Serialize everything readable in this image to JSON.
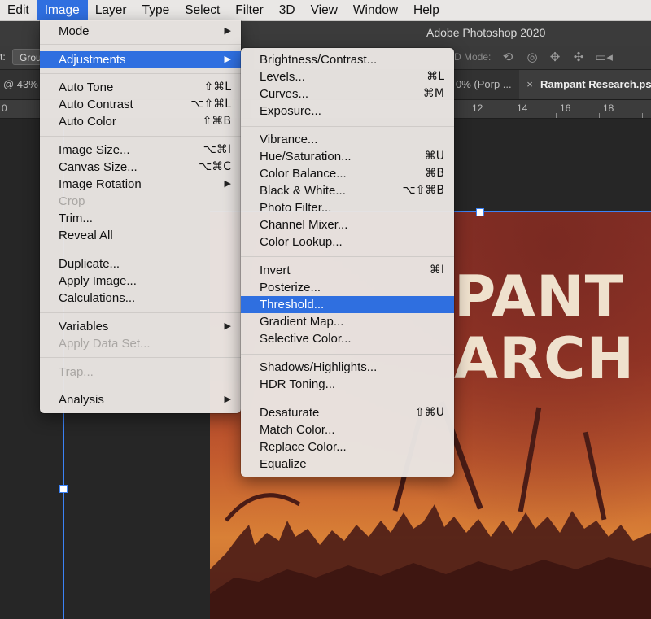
{
  "menubar": {
    "items": [
      "Edit",
      "Image",
      "Layer",
      "Type",
      "Select",
      "Filter",
      "3D",
      "View",
      "Window",
      "Help"
    ],
    "active": "Image"
  },
  "app_title": "Adobe Photoshop 2020",
  "options": {
    "label": "t:",
    "select_value": "Grou",
    "mode_3d": "D Mode:",
    "icons": [
      "orbit-icon",
      "roll-icon",
      "pan-icon",
      "slide-icon",
      "video-camera-icon"
    ]
  },
  "tabs": {
    "left": "@ 43%",
    "middle": "0% (Porp ...",
    "active": "Rampant Research.ps",
    "close_glyph": "×"
  },
  "ruler": {
    "numbers": [
      "0",
      "12",
      "14",
      "16",
      "18"
    ]
  },
  "poster": {
    "line1": "PANT",
    "line2": "ARCH"
  },
  "image_menu": {
    "items": [
      {
        "label": "Mode",
        "submenu": true
      },
      {
        "separator": true
      },
      {
        "label": "Adjustments",
        "submenu": true,
        "highlighted": true
      },
      {
        "separator": true
      },
      {
        "label": "Auto Tone",
        "shortcut": "⇧⌘L"
      },
      {
        "label": "Auto Contrast",
        "shortcut": "⌥⇧⌘L"
      },
      {
        "label": "Auto Color",
        "shortcut": "⇧⌘B"
      },
      {
        "separator": true
      },
      {
        "label": "Image Size...",
        "shortcut": "⌥⌘I"
      },
      {
        "label": "Canvas Size...",
        "shortcut": "⌥⌘C"
      },
      {
        "label": "Image Rotation",
        "submenu": true
      },
      {
        "label": "Crop",
        "disabled": true
      },
      {
        "label": "Trim..."
      },
      {
        "label": "Reveal All"
      },
      {
        "separator": true
      },
      {
        "label": "Duplicate..."
      },
      {
        "label": "Apply Image..."
      },
      {
        "label": "Calculations..."
      },
      {
        "separator": true
      },
      {
        "label": "Variables",
        "submenu": true
      },
      {
        "label": "Apply Data Set...",
        "disabled": true
      },
      {
        "separator": true
      },
      {
        "label": "Trap...",
        "disabled": true
      },
      {
        "separator": true
      },
      {
        "label": "Analysis",
        "submenu": true
      }
    ]
  },
  "adjustments_menu": {
    "items": [
      {
        "label": "Brightness/Contrast..."
      },
      {
        "label": "Levels...",
        "shortcut": "⌘L"
      },
      {
        "label": "Curves...",
        "shortcut": "⌘M"
      },
      {
        "label": "Exposure..."
      },
      {
        "separator": true
      },
      {
        "label": "Vibrance..."
      },
      {
        "label": "Hue/Saturation...",
        "shortcut": "⌘U"
      },
      {
        "label": "Color Balance...",
        "shortcut": "⌘B"
      },
      {
        "label": "Black & White...",
        "shortcut": "⌥⇧⌘B"
      },
      {
        "label": "Photo Filter..."
      },
      {
        "label": "Channel Mixer..."
      },
      {
        "label": "Color Lookup..."
      },
      {
        "separator": true
      },
      {
        "label": "Invert",
        "shortcut": "⌘I"
      },
      {
        "label": "Posterize..."
      },
      {
        "label": "Threshold...",
        "highlighted": true
      },
      {
        "label": "Gradient Map..."
      },
      {
        "label": "Selective Color..."
      },
      {
        "separator": true
      },
      {
        "label": "Shadows/Highlights..."
      },
      {
        "label": "HDR Toning..."
      },
      {
        "separator": true
      },
      {
        "label": "Desaturate",
        "shortcut": "⇧⌘U"
      },
      {
        "label": "Match Color..."
      },
      {
        "label": "Replace Color..."
      },
      {
        "label": "Equalize"
      }
    ]
  },
  "colors": {
    "highlight": "#2f6fe0",
    "guide": "#3b82f6",
    "poster_text": "#efe1cd"
  }
}
